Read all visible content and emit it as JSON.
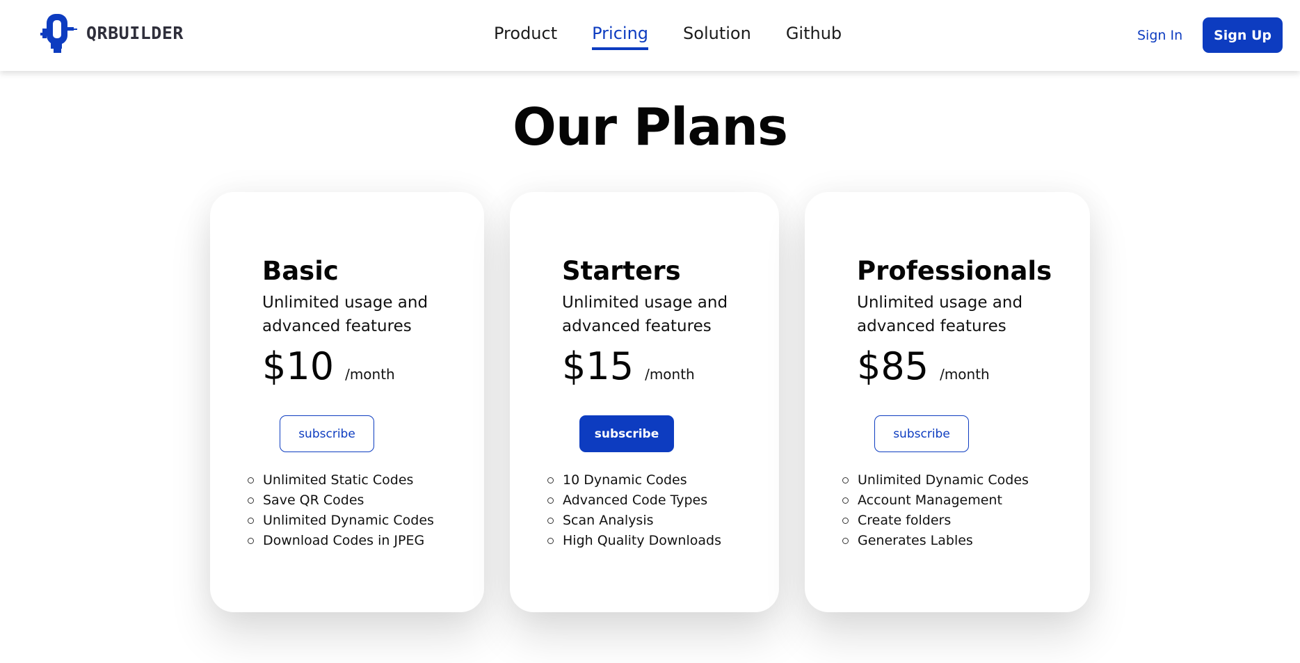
{
  "brand": {
    "name": "QRBUILDER",
    "accent": "#0d3cc0"
  },
  "nav": {
    "items": [
      {
        "label": "Product",
        "active": false
      },
      {
        "label": "Pricing",
        "active": true
      },
      {
        "label": "Solution",
        "active": false
      },
      {
        "label": "Github",
        "active": false
      }
    ],
    "sign_in": "Sign In",
    "sign_up": "Sign Up"
  },
  "page": {
    "title": "Our Plans"
  },
  "plans": [
    {
      "name": "Basic",
      "description": "Unlimited usage and advanced features",
      "price": "$10",
      "period": "/month",
      "button": "subscribe",
      "button_style": "outline",
      "features": [
        "Unlimited Static Codes",
        "Save QR Codes",
        "Unlimited Dynamic Codes",
        "Download Codes in JPEG"
      ]
    },
    {
      "name": "Starters",
      "description": "Unlimited usage and advanced features",
      "price": "$15",
      "period": "/month",
      "button": "subscribe",
      "button_style": "filled",
      "features": [
        "10 Dynamic Codes",
        "Advanced Code Types",
        "Scan Analysis",
        "High Quality Downloads"
      ]
    },
    {
      "name": "Professionals",
      "description": "Unlimited usage and advanced features",
      "price": "$85",
      "period": "/month",
      "button": "subscribe",
      "button_style": "outline",
      "features": [
        "Unlimited Dynamic Codes",
        "Account Management",
        "Create folders",
        "Generates Lables"
      ]
    }
  ]
}
